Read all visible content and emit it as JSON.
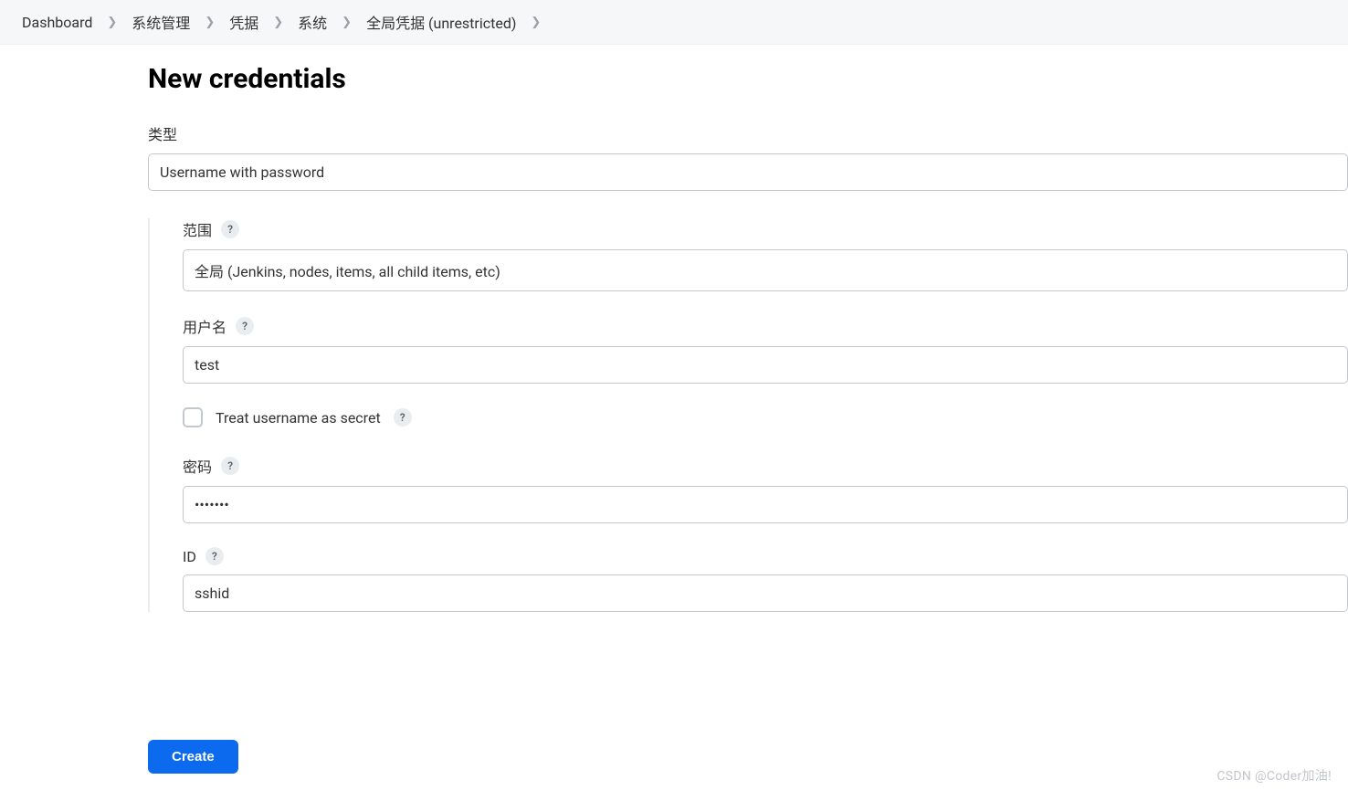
{
  "breadcrumb": {
    "items": [
      {
        "label": "Dashboard"
      },
      {
        "label": "系统管理"
      },
      {
        "label": "凭据"
      },
      {
        "label": "系统"
      },
      {
        "label": "全局凭据 (unrestricted)"
      }
    ]
  },
  "page": {
    "title": "New credentials"
  },
  "form": {
    "type": {
      "label": "类型",
      "value": "Username with password"
    },
    "scope": {
      "label": "范围",
      "value": "全局 (Jenkins, nodes, items, all child items, etc)"
    },
    "username": {
      "label": "用户名",
      "value": "test"
    },
    "treat_secret": {
      "label": "Treat username as secret",
      "checked": false
    },
    "password": {
      "label": "密码",
      "value": "•••••••"
    },
    "id": {
      "label": "ID",
      "value": "sshid"
    }
  },
  "buttons": {
    "create": "Create"
  },
  "watermark": "CSDN @Coder加油!",
  "help_glyph": "?"
}
